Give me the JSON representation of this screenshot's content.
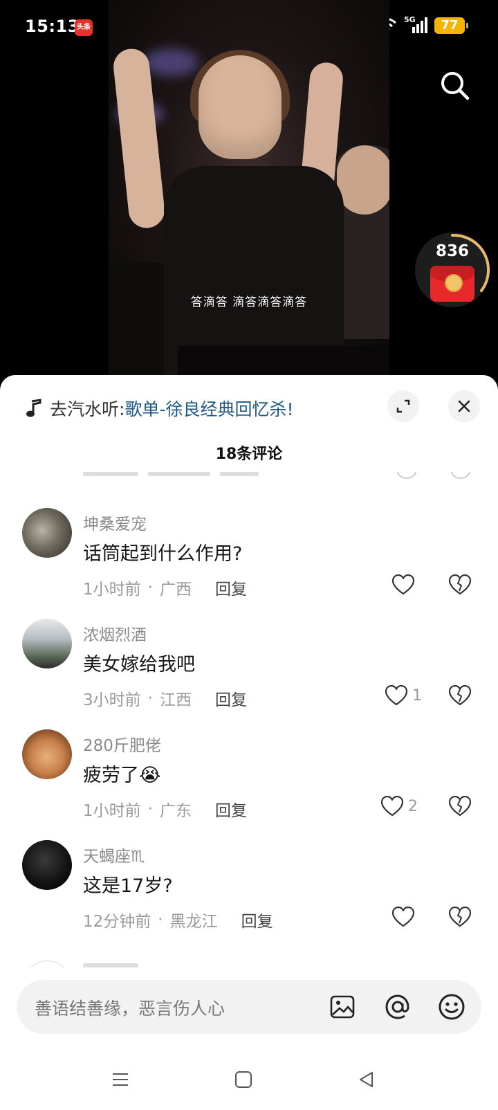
{
  "status_bar": {
    "time": "15:13",
    "app_badge": "头条",
    "network": "5G",
    "battery": "77"
  },
  "video": {
    "subtitle": "答滴答 滴答滴答滴答"
  },
  "red_packet": {
    "count": "836"
  },
  "comments_panel": {
    "promo_prefix": "去汽水听: ",
    "promo_link": "歌单-徐良经典回忆杀!",
    "title": "18条评论",
    "comments": [
      {
        "author": "坤桑爱宠",
        "text": "话筒起到什么作用?",
        "time": "1小时前",
        "location": "广西",
        "reply": "回复",
        "likes": ""
      },
      {
        "author": "浓烟烈酒",
        "text": "美女嫁给我吧",
        "time": "3小时前",
        "location": "江西",
        "reply": "回复",
        "likes": "1"
      },
      {
        "author": "280斤肥佬",
        "text": "疲劳了😭",
        "time": "1小时前",
        "location": "广东",
        "reply": "回复",
        "likes": "2"
      },
      {
        "author": "天蝎座♏",
        "text": "这是17岁?",
        "time": "12分钟前",
        "location": "黑龙江",
        "reply": "回复",
        "likes": ""
      }
    ],
    "input_placeholder": "善语结善缘，恶言伤人心"
  }
}
